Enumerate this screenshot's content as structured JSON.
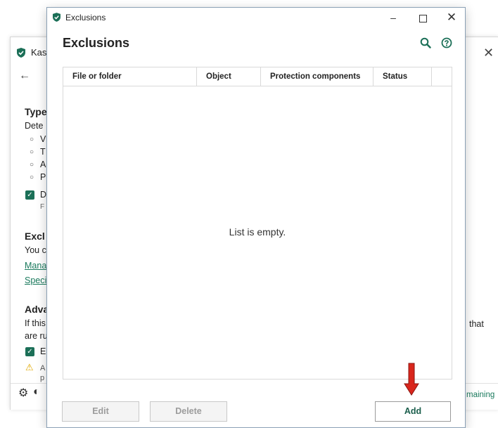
{
  "background_window": {
    "title": "Kas",
    "back_glyph": "←",
    "close_glyph": "✕",
    "section_types": {
      "heading": "Type",
      "line": "Dete",
      "bullets": [
        "V",
        "T",
        "A",
        "P"
      ],
      "checkbox_label": "D",
      "checkbox_sub": "F"
    },
    "section_exclusions": {
      "heading": "Excl",
      "line": "You c",
      "link_manage": "Mana",
      "link_specify": "Speci"
    },
    "section_advanced": {
      "heading": "Adva",
      "line1": "If this",
      "line2": "are ru",
      "checkbox_label": "E",
      "warning_l1": "A",
      "warning_l2": "p",
      "right_text": "that"
    },
    "footer_right": "maining"
  },
  "dialog": {
    "window_title": "Exclusions",
    "heading": "Exclusions",
    "controls": {
      "minimize": "–",
      "close": "✕"
    },
    "columns": [
      "File or folder",
      "Object",
      "Protection components",
      "Status"
    ],
    "empty_text": "List is empty.",
    "buttons": {
      "edit": "Edit",
      "delete": "Delete",
      "add": "Add"
    }
  },
  "colors": {
    "accent": "#1b6f57",
    "link": "#1a7a5d",
    "annotation_arrow": "#d9261c",
    "warning": "#e0a800"
  },
  "icons": [
    "kaspersky-shield-icon",
    "search-icon",
    "help-icon",
    "gear-icon",
    "warning-icon",
    "red-down-arrow-icon"
  ]
}
